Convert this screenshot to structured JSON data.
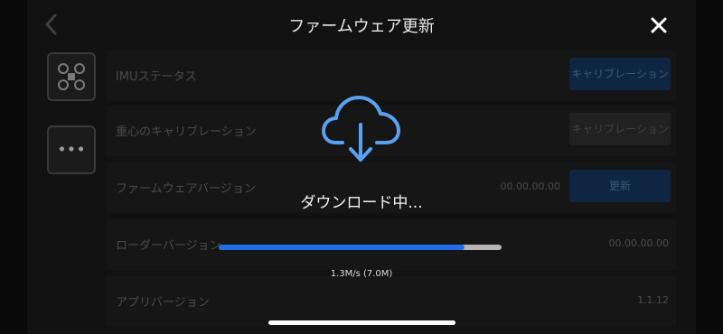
{
  "header": {
    "title": "ファームウェア更新"
  },
  "rows": [
    {
      "label": "IMUステータス",
      "button_label": "キャリブレーション",
      "button_style": "blue"
    },
    {
      "label": "重心のキャリブレーション",
      "button_label": "キャリブレーション",
      "button_style": "gray"
    },
    {
      "label": "ファームウェアバージョン",
      "value": "00.00.00.00",
      "button_label": "更新",
      "button_style": "blue"
    },
    {
      "label": "ローダーバージョン",
      "value": "00.00.00.00"
    },
    {
      "label": "アプリバージョン",
      "value": "1.1.12"
    }
  ],
  "download": {
    "status_text": "ダウンロード中...",
    "speed_text": "1.3M/s (7.0M)",
    "progress_fraction": 0.87
  },
  "icons": {
    "back": "chevron-left-icon",
    "close": "close-icon",
    "cloud": "cloud-download-icon",
    "side1": "drone-icon",
    "side2": "more-icon"
  },
  "colors": {
    "accent": "#1f6ee8",
    "cloud": "#5aa2f0",
    "track": "#b5b5b5"
  }
}
